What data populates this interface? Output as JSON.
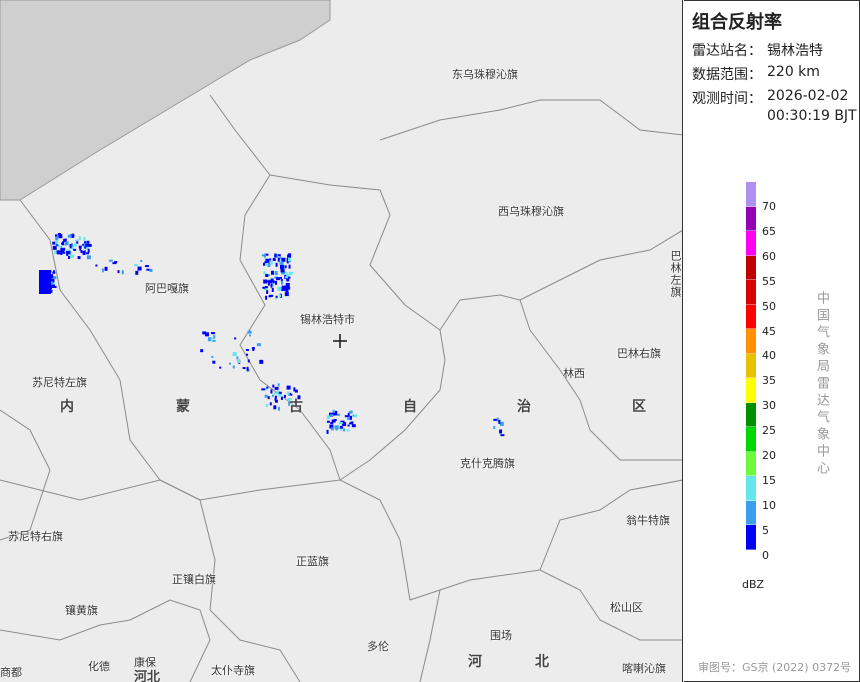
{
  "panel": {
    "title": "组合反射率",
    "station_label": "雷达站名：",
    "station": "锡林浩特",
    "range_label": "数据范围：",
    "range": "220 km",
    "time_label": "观测时间：",
    "date": "2026-02-02",
    "time": "00:30:19 BJT",
    "legend": {
      "unit": "dBZ",
      "ticks": [
        "70",
        "65",
        "60",
        "55",
        "50",
        "45",
        "40",
        "35",
        "30",
        "25",
        "20",
        "15",
        "10",
        "5",
        "0"
      ],
      "colors": [
        "#ad90f0",
        "#9600b4",
        "#ff00f0",
        "#c00000",
        "#d60000",
        "#ff0000",
        "#ff9000",
        "#e7c000",
        "#ffff00",
        "#009000",
        "#00d800",
        "#6efa3c",
        "#64e7eb",
        "#3c9ef0",
        "#0000f6"
      ]
    },
    "credit": "中国气象局雷达气象中心",
    "approval": "审图号：GS京 (2022) 0372号"
  },
  "map": {
    "labels": [
      "东乌珠穆沁旗",
      "西乌珠穆沁旗",
      "阿巴嘎旗",
      "锡林浩特市",
      "苏尼特左旗",
      "林西",
      "巴林右旗",
      "巴林左旗",
      "克什克腾旗",
      "苏尼特右旗",
      "翁牛特旗",
      "正蓝旗",
      "正镶白旗",
      "镶黄旗",
      "松山区",
      "多伦",
      "围场",
      "商都",
      "化德",
      "康保",
      "太仆寺旗",
      "喀喇沁旗"
    ],
    "region": [
      "内",
      "蒙",
      "古",
      "自",
      "治",
      "区"
    ],
    "hebei": [
      "河",
      "北"
    ],
    "hebei2": "河北"
  }
}
